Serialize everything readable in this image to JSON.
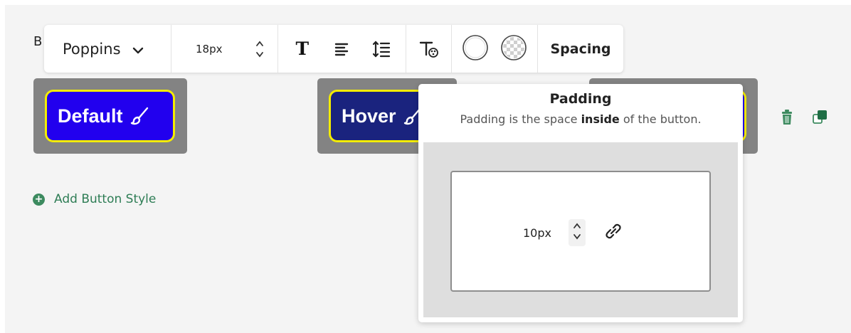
{
  "section_initial": "B",
  "toolbar": {
    "font": "Poppins",
    "font_size": "18px",
    "spacing_label": "Spacing"
  },
  "buttons": [
    {
      "label": "Default",
      "bg": "#2200ee",
      "border": "#f3ec00"
    },
    {
      "label": "Hover",
      "bg": "#1a237e",
      "border": "#f3ec00"
    }
  ],
  "add_button_style": "Add Button Style",
  "popover": {
    "title": "Padding",
    "desc_before": "Padding is the space ",
    "desc_bold": "inside",
    "desc_after": " of the button.",
    "value": "10px"
  },
  "icons": [
    "chevron-down-icon",
    "stepper-icon",
    "text-style-icon",
    "align-icon",
    "line-height-icon",
    "text-effects-icon",
    "outline-circle-icon",
    "transparent-circle-icon",
    "paintbrush-icon",
    "plus-circle-icon",
    "trash-icon",
    "duplicate-icon",
    "link-icon"
  ],
  "colors": {
    "accent": "#2e7d55",
    "card": "#838383",
    "canvas": "#f4f4f4"
  }
}
